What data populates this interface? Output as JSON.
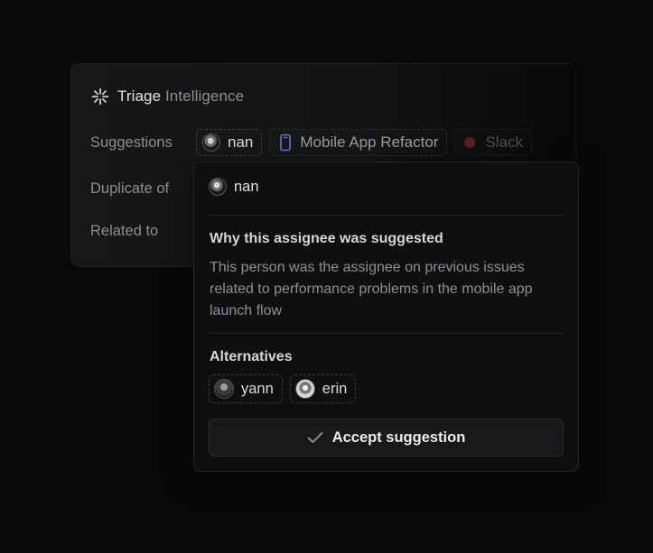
{
  "card": {
    "title": "Triage",
    "title_fade": "Intelligence",
    "rows": {
      "suggestions_label": "Suggestions",
      "duplicate_label": "Duplicate of",
      "related_label": "Related to"
    },
    "chips": {
      "assignee": "nan",
      "project": "Mobile App Refactor",
      "channel": "Slack"
    }
  },
  "popover": {
    "assignee_name": "nan",
    "why_title": "Why this assignee was suggested",
    "why_body": "This person was the assignee on previous issues related to performance problems in the mobile app launch flow",
    "alternatives_title": "Alternatives",
    "alternatives": [
      {
        "name": "yann"
      },
      {
        "name": "erin"
      }
    ],
    "accept_label": "Accept suggestion"
  },
  "icons": {
    "header": "sparkle-icon",
    "project": "phone-icon",
    "channel": "slack-icon",
    "accept": "check-icon"
  },
  "colors": {
    "background": "#08090a",
    "project_icon": "#6b73c9",
    "slack_dot": "#5a2020"
  }
}
